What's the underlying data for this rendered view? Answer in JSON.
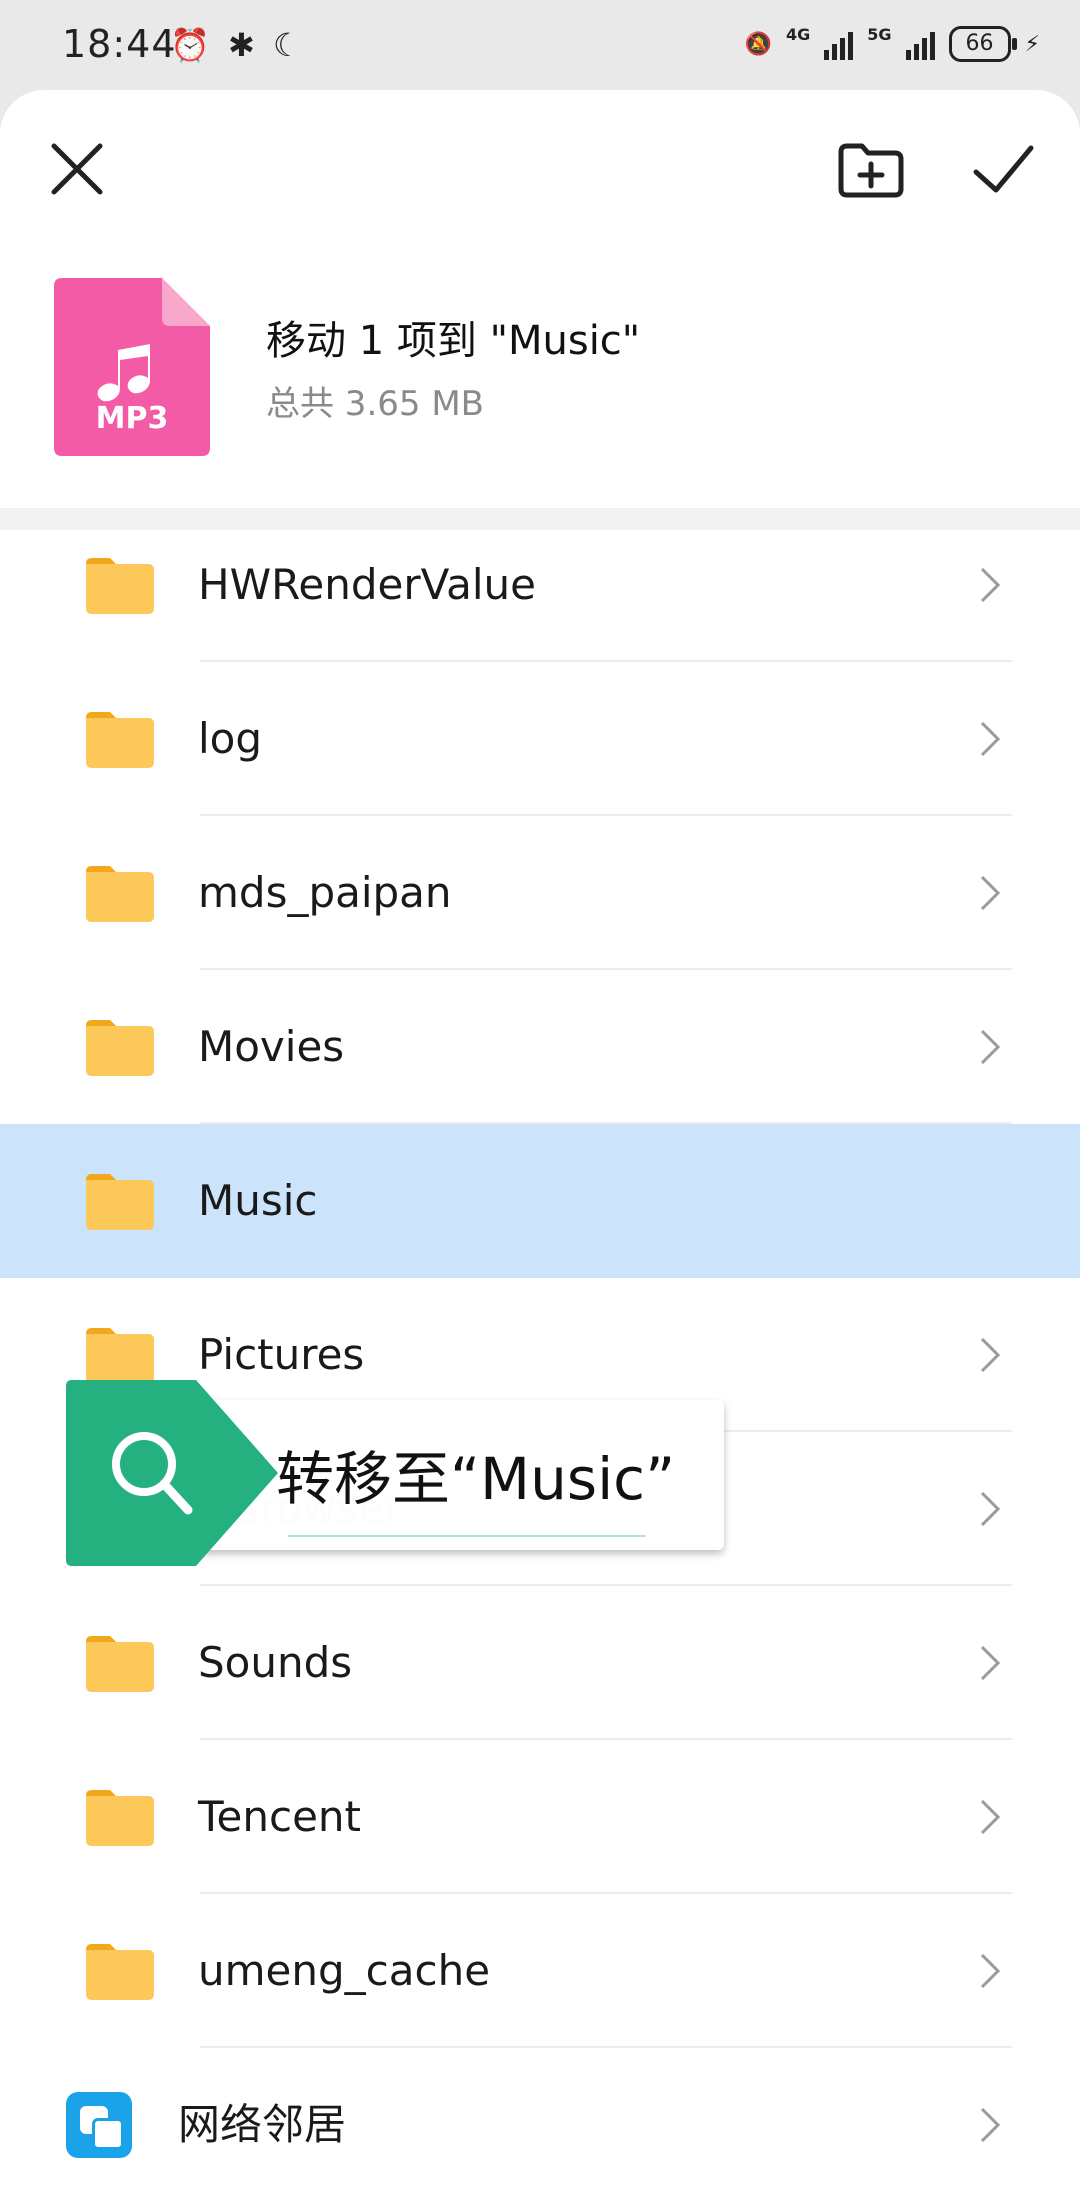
{
  "status_bar": {
    "time": "18:44",
    "left_icons": [
      "alarm-icon",
      "bluetooth-icon",
      "moon-icon"
    ],
    "right_icons": [
      "mute-bell-icon",
      "signal-4g-icon",
      "signal-5g-icon",
      "battery-icon",
      "charging-icon"
    ],
    "net_1": "4G",
    "net_2": "5G",
    "battery": "66"
  },
  "toolbar": {
    "close_icon": "close-icon",
    "new_folder_icon": "new-folder-icon",
    "confirm_icon": "check-icon"
  },
  "move_info": {
    "file_badge": "MP3",
    "title": "移动 1 项到 \"Music\"",
    "subtitle": "总共 3.65 MB"
  },
  "folders": [
    {
      "name": "HWRenderValue",
      "selected": false
    },
    {
      "name": "log",
      "selected": false
    },
    {
      "name": "mds_paipan",
      "selected": false
    },
    {
      "name": "Movies",
      "selected": false
    },
    {
      "name": "Music",
      "selected": true
    },
    {
      "name": "Pictures",
      "selected": false
    },
    {
      "name": "QBrowser",
      "selected": false
    },
    {
      "name": "Sounds",
      "selected": false
    },
    {
      "name": "Tencent",
      "selected": false
    },
    {
      "name": "umeng_cache",
      "selected": false
    }
  ],
  "network_neighbor": {
    "label": "网络邻居"
  },
  "overlay": {
    "text": "转移至“Music”"
  },
  "colors": {
    "folder": "#fcc85a",
    "selected_row": "#cce4fb",
    "mp3_icon": "#f45ba7",
    "overlay_badge": "#25b07f",
    "neighbor_icon": "#1aa3e8"
  }
}
